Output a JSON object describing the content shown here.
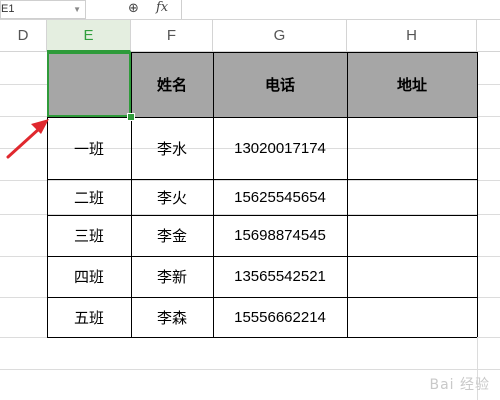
{
  "formula_bar": {
    "name_box_value": "E1",
    "zoom_icon": "zoom-icon",
    "fx_label": "fx",
    "formula_value": ""
  },
  "columns": [
    {
      "letter": "D"
    },
    {
      "letter": "E"
    },
    {
      "letter": "F"
    },
    {
      "letter": "G"
    },
    {
      "letter": "H"
    }
  ],
  "table": {
    "headers": [
      "",
      "姓名",
      "电话",
      "地址"
    ],
    "rows": [
      [
        "一班",
        "李水",
        "13020017174",
        ""
      ],
      [
        "二班",
        "李火",
        "15625545654",
        ""
      ],
      [
        "三班",
        "李金",
        "15698874545",
        ""
      ],
      [
        "四班",
        "李新",
        "13565542521",
        ""
      ],
      [
        "五班",
        "李森",
        "15556662214",
        ""
      ]
    ]
  },
  "colors": {
    "selection": "#2e9b3a",
    "header_fill": "#a6a6a6",
    "arrow": "#e0282e"
  },
  "watermark": "Bai 经验"
}
